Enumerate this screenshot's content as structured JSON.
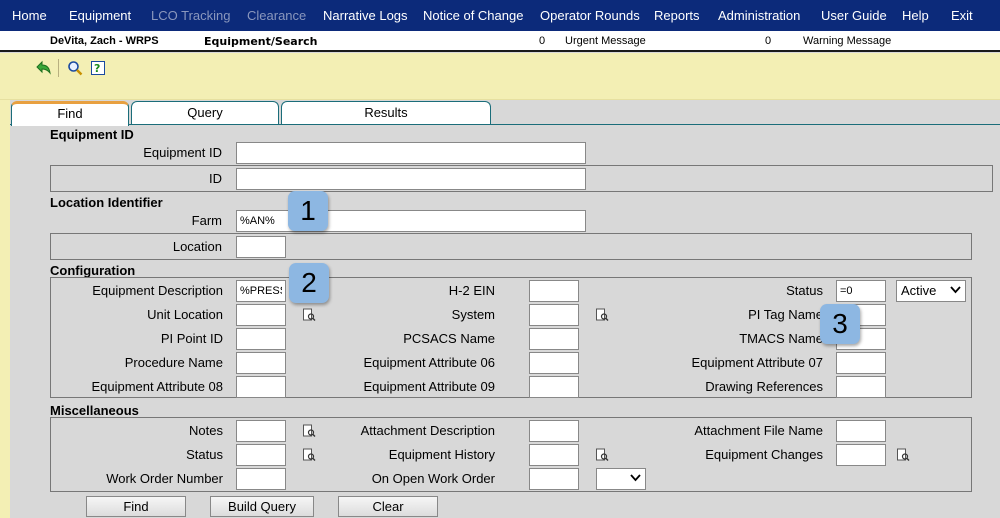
{
  "menu": {
    "items": [
      {
        "label": "Home",
        "disabled": false
      },
      {
        "label": "Equipment",
        "disabled": false
      },
      {
        "label": "LCO Tracking",
        "disabled": true
      },
      {
        "label": "Clearance",
        "disabled": true
      },
      {
        "label": "Narrative Logs",
        "disabled": false
      },
      {
        "label": "Notice of Change",
        "disabled": false
      },
      {
        "label": "Operator Rounds",
        "disabled": false
      },
      {
        "label": "Reports",
        "disabled": false
      },
      {
        "label": "Administration",
        "disabled": false
      },
      {
        "label": "User Guide",
        "disabled": false
      },
      {
        "label": "Help",
        "disabled": false
      },
      {
        "label": "Exit",
        "disabled": false
      }
    ]
  },
  "infobar": {
    "user": "DeVita, Zach - WRPS",
    "path": "Equipment/Search",
    "urgent_count": "0",
    "urgent_label": "Urgent Message",
    "warning_count": "0",
    "warning_label": "Warning Message"
  },
  "toolbar": {
    "icons": [
      "back-arrow-icon",
      "search-magnifier-icon",
      "help-document-icon"
    ]
  },
  "tabs": {
    "find": "Find",
    "query": "Query",
    "results": "Results"
  },
  "sections": {
    "equipment_id": {
      "title": "Equipment ID",
      "equipment_id_label": "Equipment ID",
      "equipment_id_value": "",
      "id_label": "ID",
      "id_value": ""
    },
    "location": {
      "title": "Location Identifier",
      "farm_label": "Farm",
      "farm_value": "%AN%",
      "location_label": "Location",
      "location_value": ""
    },
    "configuration": {
      "title": "Configuration",
      "equipment_description_label": "Equipment Description",
      "equipment_description_value": "%PRESS",
      "h2_ein_label": "H-2 EIN",
      "h2_ein_value": "",
      "status_label": "Status",
      "status_value": "=0",
      "status_select": "Active",
      "unit_location_label": "Unit Location",
      "system_label": "System",
      "pi_tag_name_label": "PI Tag Name",
      "pi_point_id_label": "PI Point ID",
      "pcsacs_name_label": "PCSACS Name",
      "tmacs_name_label": "TMACS Name",
      "procedure_name_label": "Procedure Name",
      "attr06_label": "Equipment Attribute 06",
      "attr07_label": "Equipment Attribute 07",
      "attr08_label": "Equipment Attribute 08",
      "attr09_label": "Equipment Attribute 09",
      "drawing_refs_label": "Drawing References"
    },
    "misc": {
      "title": "Miscellaneous",
      "notes_label": "Notes",
      "attachment_description_label": "Attachment Description",
      "attachment_file_name_label": "Attachment File Name",
      "status_label": "Status",
      "equipment_history_label": "Equipment History",
      "equipment_changes_label": "Equipment Changes",
      "work_order_number_label": "Work Order Number",
      "on_open_work_order_label": "On Open Work Order",
      "on_open_work_order_value": ""
    }
  },
  "buttons": {
    "find": "Find",
    "build_query": "Build Query",
    "clear": "Clear"
  },
  "callouts": [
    "1",
    "2",
    "3"
  ]
}
